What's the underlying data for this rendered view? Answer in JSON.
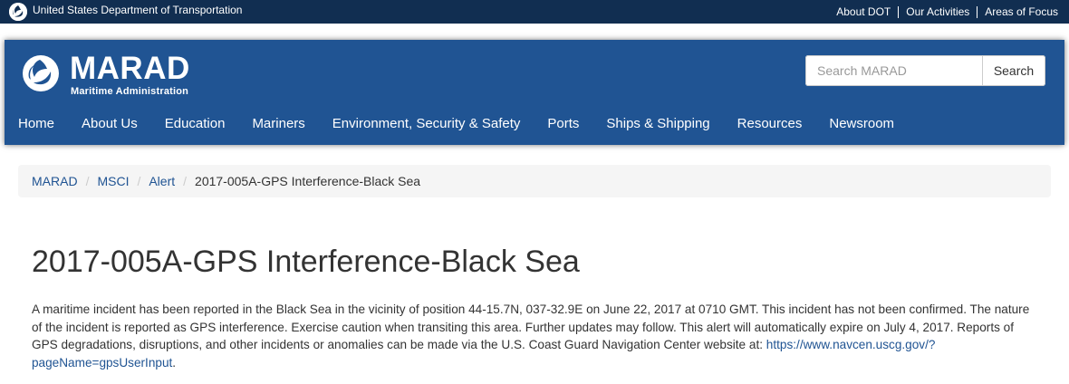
{
  "dot_bar": {
    "title": "United States Department of Transportation",
    "links": [
      "About DOT",
      "Our Activities",
      "Areas of Focus"
    ]
  },
  "header": {
    "brand_name": "MARAD",
    "brand_subtitle": "Maritime Administration",
    "search": {
      "placeholder": "Search MARAD",
      "value": "",
      "button_label": "Search"
    },
    "nav": [
      "Home",
      "About Us",
      "Education",
      "Mariners",
      "Environment, Security & Safety",
      "Ports",
      "Ships & Shipping",
      "Resources",
      "Newsroom"
    ]
  },
  "breadcrumb": {
    "items": [
      "MARAD",
      "MSCI",
      "Alert"
    ],
    "current": "2017-005A-GPS Interference-Black Sea"
  },
  "main": {
    "title": "2017-005A-GPS Interference-Black Sea",
    "body": "A maritime incident has been reported in the Black Sea in the vicinity of position 44-15.7N, 037-32.9E on June 22, 2017 at 0710 GMT. This incident has not been confirmed. The nature of the incident is reported as GPS interference. Exercise caution when transiting this area. Further updates may follow. This alert will automatically expire on July 4, 2017. Reports of GPS degradations, disruptions, and other incidents or anomalies can be made via the U.S. Coast Guard Navigation Center website at: ",
    "link_text": "https://www.navcen.uscg.gov/?pageName=gpsUserInput",
    "trailing": "."
  },
  "colors": {
    "dot_bar": "#112e51",
    "header": "#205493",
    "link": "#205493",
    "breadcrumb_bg": "#f5f5f5"
  },
  "icons": [
    "dot-logo-icon",
    "marad-logo-icon"
  ]
}
